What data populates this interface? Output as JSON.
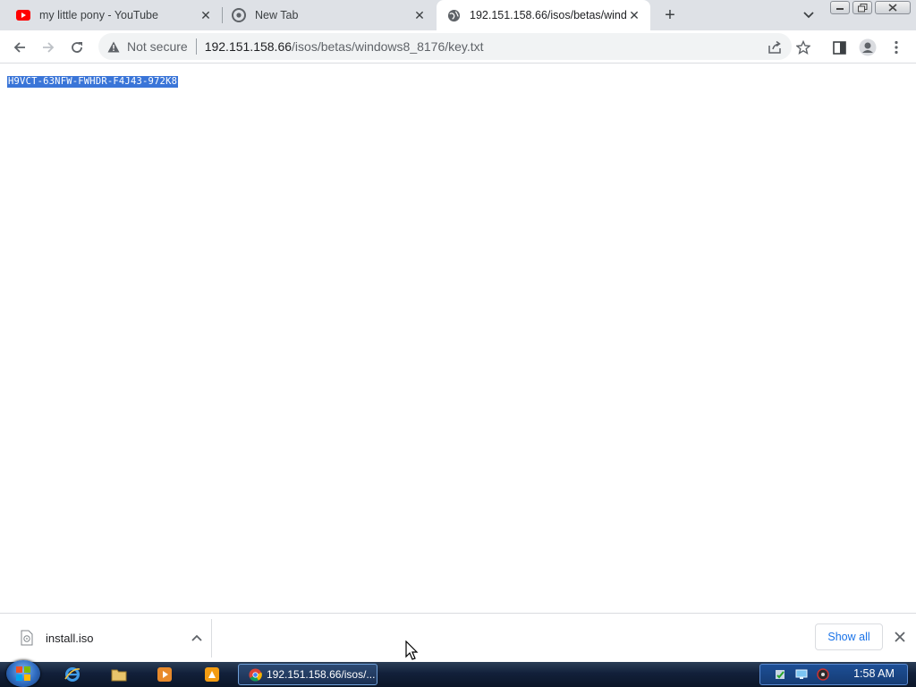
{
  "tabs": [
    {
      "title": "my little pony - YouTube",
      "favicon": "youtube-icon"
    },
    {
      "title": "New Tab",
      "favicon": "chrome-icon"
    },
    {
      "title": "192.151.158.66/isos/betas/windo",
      "favicon": "globe-icon",
      "active": true
    }
  ],
  "toolbar": {
    "security_label": "Not secure",
    "url_host": "192.151.158.66",
    "url_path": "/isos/betas/windows8_8176/key.txt"
  },
  "content": {
    "text": "H9VCT-63NFW-FWHDR-F4J43-972K8"
  },
  "downloads": {
    "file_name": "install.iso",
    "show_all_label": "Show all"
  },
  "taskbar": {
    "active_window_label": "192.151.158.66/isos/...",
    "clock": "1:58 AM"
  },
  "colors": {
    "selection": "#3a75d8",
    "link_blue": "#1a73e8",
    "tabstrip_bg": "#dee1e6"
  }
}
